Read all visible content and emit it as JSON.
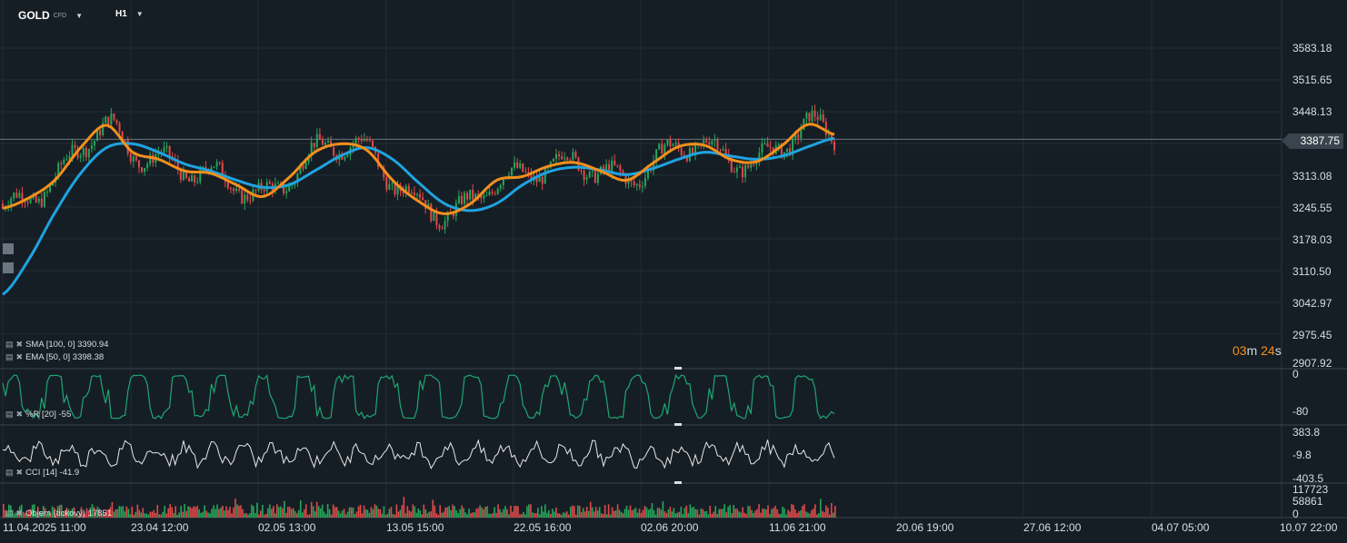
{
  "header": {
    "symbol": "GOLD",
    "symbol_suffix": "CFD",
    "timeframe": "H1"
  },
  "price_axis": [
    "3583.18",
    "3515.65",
    "3448.13",
    "3387.75",
    "3313.08",
    "3245.55",
    "3178.03",
    "3110.50",
    "3042.97",
    "2975.45",
    "2907.92"
  ],
  "current_price": "3387.75",
  "timer": {
    "minutes": "03",
    "m_unit": "m",
    "seconds": "24",
    "s_unit": "s"
  },
  "indicators": {
    "sma": "SMA [100,  0] 3390.94",
    "ema": "EMA [50,  0] 3398.38",
    "wr": {
      "label": "%R [20]  -55",
      "axis": [
        "0",
        "-80"
      ]
    },
    "cci": {
      "label": "CCI [14]  -41.9",
      "axis": [
        "383.8",
        "-9.8",
        "-403.5"
      ]
    },
    "vol": {
      "label": "Objem  (tickový)  17851",
      "axis": [
        "117723",
        "58861",
        "0"
      ]
    }
  },
  "time_axis": [
    "11.04.2025   11:00",
    "23.04  12:00",
    "02.05  13:00",
    "13.05  15:00",
    "22.05  16:00",
    "02.06  20:00",
    "11.06  21:00",
    "20.06  19:00",
    "27.06  12:00",
    "04.07  05:00",
    "10.07  22:00"
  ],
  "colors": {
    "background": "#161e25",
    "up": "#26a65b",
    "down": "#e04a4a",
    "ema": "#f28f1d",
    "sma": "#1fa3e0",
    "wr": "#1ea672",
    "cci": "#e8e8e8",
    "grid": "#222c35"
  },
  "chart_data": {
    "type": "line",
    "ylim": [
      2907.92,
      3583.18
    ],
    "series": [
      {
        "name": "EMA [50, 0]",
        "values": [
          3240,
          3262,
          3300,
          3370,
          3418,
          3360,
          3345,
          3320,
          3315,
          3290,
          3265,
          3305,
          3360,
          3378,
          3365,
          3300,
          3255,
          3228,
          3250,
          3300,
          3308,
          3330,
          3338,
          3320,
          3300,
          3336,
          3372,
          3375,
          3345,
          3340,
          3375,
          3420,
          3398
        ]
      },
      {
        "name": "SMA [100, 0]",
        "values": [
          3055,
          3130,
          3230,
          3315,
          3370,
          3378,
          3360,
          3335,
          3320,
          3300,
          3285,
          3290,
          3320,
          3352,
          3370,
          3345,
          3295,
          3250,
          3235,
          3250,
          3290,
          3318,
          3328,
          3322,
          3312,
          3325,
          3345,
          3360,
          3352,
          3345,
          3352,
          3372,
          3390
        ]
      }
    ]
  }
}
